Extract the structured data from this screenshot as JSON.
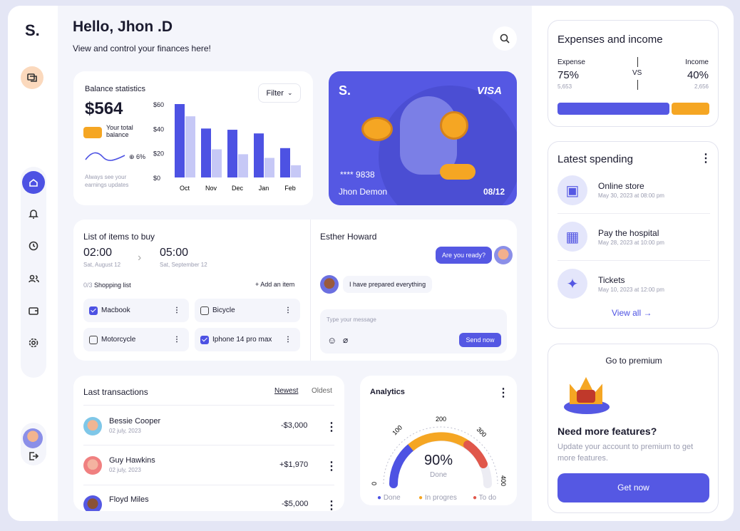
{
  "brand": "S.",
  "header": {
    "greeting": "Hello, Jhon .D",
    "subtitle": "View and control your finances here!"
  },
  "balance": {
    "title": "Balance statistics",
    "filter": "Filter",
    "amount": "$564",
    "total_label": "Your total balance",
    "change": "6%",
    "note": "Always see your earnings updates",
    "chart_data": {
      "type": "bar",
      "categories": [
        "Oct",
        "Nov",
        "Dec",
        "Jan",
        "Feb"
      ],
      "y_ticks": [
        "$60",
        "$40",
        "$20",
        "$0"
      ],
      "ylim": [
        0,
        60
      ],
      "series": [
        {
          "values": [
            60,
            40,
            39,
            36,
            24
          ]
        },
        {
          "values": [
            50,
            23,
            19,
            16,
            10
          ]
        }
      ],
      "colors": [
        "#4d52e3",
        "#c6c8f6"
      ]
    }
  },
  "visa": {
    "brand": "S.",
    "network": "VISA",
    "number": "**** 9838",
    "holder": "Jhon Demon",
    "expiry": "08/12"
  },
  "shopping": {
    "title": "List of items to buy",
    "time_start": "02:00",
    "date_start": "Sat, August 12",
    "time_end": "05:00",
    "date_end": "Sat, September 12",
    "count": "0/3",
    "list_label": "Shopping list",
    "add": "+ Add an item",
    "items": [
      {
        "label": "Macbook",
        "checked": true
      },
      {
        "label": "Bicycle",
        "checked": false
      },
      {
        "label": "Motorcycle",
        "checked": false
      },
      {
        "label": "Iphone 14 pro max",
        "checked": true
      }
    ]
  },
  "chat": {
    "name": "Esther Howard",
    "msg_out": "Are you ready?",
    "msg_in": "I have prepared everything",
    "placeholder": "Type your message",
    "send": "Send now"
  },
  "transactions": {
    "title": "Last transactions",
    "sort_new": "Newest",
    "sort_old": "Oldest",
    "rows": [
      {
        "name": "Bessie Cooper",
        "date": "02 july, 2023",
        "amount": "-$3,000"
      },
      {
        "name": "Guy Hawkins",
        "date": "02 july, 2023",
        "amount": "+$1,970"
      },
      {
        "name": "Floyd Miles",
        "date": "",
        "amount": "-$5,000"
      }
    ]
  },
  "analytics": {
    "title": "Analytics",
    "percent": "90%",
    "status": "Done",
    "ticks": [
      "0",
      "100",
      "200",
      "300",
      "400"
    ],
    "legend": [
      "Done",
      "In progres",
      "To do"
    ],
    "colors": [
      "#4d52e3",
      "#f5a623",
      "#e0574b"
    ]
  },
  "expenses": {
    "title": "Expenses and income",
    "expense_label": "Expense",
    "expense_pct": "75%",
    "expense_val": "5,653",
    "vs": "VS",
    "income_label": "Income",
    "income_pct": "40%",
    "income_val": "2,656",
    "expense_color": "#5558e3",
    "income_color": "#f5a623"
  },
  "spending": {
    "title": "Latest spending",
    "view_all": "View all",
    "items": [
      {
        "title": "Online store",
        "date": "May 30, 2023 at 08:00 pm",
        "icon": "store-icon"
      },
      {
        "title": "Pay the hospital",
        "date": "May 28, 2023 at 10:00 pm",
        "icon": "hospital-icon"
      },
      {
        "title": "Tickets",
        "date": "May 10, 2023 at 12:00 pm",
        "icon": "ticket-icon"
      }
    ]
  },
  "premium": {
    "title": "Go to premium",
    "heading": "Need more features?",
    "text": "Update your account to premium to get more features.",
    "button": "Get now"
  }
}
